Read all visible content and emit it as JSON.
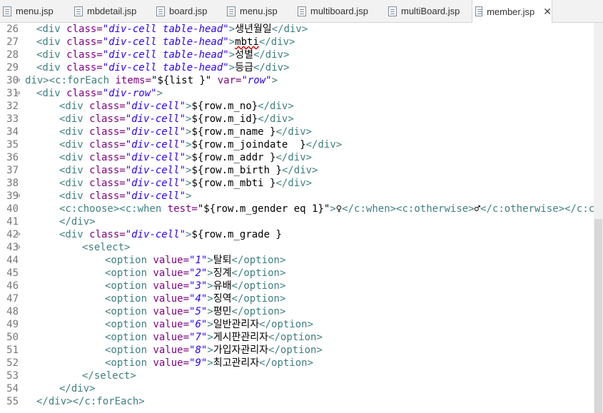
{
  "tabs": [
    {
      "label": "menu.jsp",
      "active": false
    },
    {
      "label": "mbdetail.jsp",
      "active": false
    },
    {
      "label": "board.jsp",
      "active": false
    },
    {
      "label": "menu.jsp",
      "active": false
    },
    {
      "label": "multiboard.jsp",
      "active": false
    },
    {
      "label": "multiBoard.jsp",
      "active": false
    },
    {
      "label": "member.jsp",
      "active": true
    }
  ],
  "icons": {
    "file": "jsp-file-icon",
    "close": "close-icon"
  },
  "colors": {
    "tag": "#3f7f7f",
    "attr": "#7f007f",
    "value": "#2a00ff",
    "text": "#000000",
    "line_number": "#787878"
  },
  "lines": [
    {
      "n": "26",
      "fold": "",
      "indent": 1,
      "toks": [
        [
          "tag",
          "<div "
        ],
        [
          "attr",
          "class="
        ],
        [
          "val",
          "\"div-cell table-head\""
        ],
        [
          "tag",
          ">"
        ],
        [
          "txt",
          "생년월일"
        ],
        [
          "tag",
          "</div>"
        ]
      ]
    },
    {
      "n": "27",
      "fold": "",
      "indent": 1,
      "toks": [
        [
          "tag",
          "<div "
        ],
        [
          "attr",
          "class="
        ],
        [
          "val",
          "\"div-cell table-head\""
        ],
        [
          "tag",
          ">"
        ],
        [
          "sq",
          "mbti"
        ],
        [
          "tag",
          "</div>"
        ]
      ]
    },
    {
      "n": "28",
      "fold": "",
      "indent": 1,
      "toks": [
        [
          "tag",
          "<div "
        ],
        [
          "attr",
          "class="
        ],
        [
          "val",
          "\"div-cell table-head\""
        ],
        [
          "tag",
          ">"
        ],
        [
          "txt",
          "성별"
        ],
        [
          "tag",
          "</div>"
        ]
      ]
    },
    {
      "n": "29",
      "fold": "",
      "indent": 1,
      "toks": [
        [
          "tag",
          "<div "
        ],
        [
          "attr",
          "class="
        ],
        [
          "val",
          "\"div-cell table-head\""
        ],
        [
          "tag",
          ">"
        ],
        [
          "txt",
          "등급"
        ],
        [
          "tag",
          "</div>"
        ]
      ]
    },
    {
      "n": "30",
      "fold": "⊖",
      "indent": 0,
      "toks": [
        [
          "tag",
          "div><c:forEach "
        ],
        [
          "attr",
          "items="
        ],
        [
          "txt",
          "\"${list }\" "
        ],
        [
          "attr",
          "var="
        ],
        [
          "val",
          "\"row\""
        ],
        [
          "tag",
          ">"
        ]
      ]
    },
    {
      "n": "31",
      "fold": "⊖",
      "indent": 1,
      "toks": [
        [
          "tag",
          "<div "
        ],
        [
          "attr",
          "class="
        ],
        [
          "val",
          "\"div-row\""
        ],
        [
          "tag",
          ">"
        ]
      ]
    },
    {
      "n": "32",
      "fold": "",
      "indent": 2,
      "toks": [
        [
          "tag",
          "<div "
        ],
        [
          "attr",
          "class="
        ],
        [
          "val",
          "\"div-cell\""
        ],
        [
          "tag",
          ">"
        ],
        [
          "txt",
          "${row.m_no}"
        ],
        [
          "tag",
          "</div>"
        ]
      ]
    },
    {
      "n": "33",
      "fold": "",
      "indent": 2,
      "toks": [
        [
          "tag",
          "<div "
        ],
        [
          "attr",
          "class="
        ],
        [
          "val",
          "\"div-cell\""
        ],
        [
          "tag",
          ">"
        ],
        [
          "txt",
          "${row.m_id}"
        ],
        [
          "tag",
          "</div>"
        ]
      ]
    },
    {
      "n": "34",
      "fold": "",
      "indent": 2,
      "toks": [
        [
          "tag",
          "<div "
        ],
        [
          "attr",
          "class="
        ],
        [
          "val",
          "\"div-cell\""
        ],
        [
          "tag",
          ">"
        ],
        [
          "txt",
          "${row.m_name }"
        ],
        [
          "tag",
          "</div>"
        ]
      ]
    },
    {
      "n": "35",
      "fold": "",
      "indent": 2,
      "toks": [
        [
          "tag",
          "<div "
        ],
        [
          "attr",
          "class="
        ],
        [
          "val",
          "\"div-cell\""
        ],
        [
          "tag",
          ">"
        ],
        [
          "txt",
          "${row.m_joindate  }"
        ],
        [
          "tag",
          "</div>"
        ]
      ]
    },
    {
      "n": "36",
      "fold": "",
      "indent": 2,
      "toks": [
        [
          "tag",
          "<div "
        ],
        [
          "attr",
          "class="
        ],
        [
          "val",
          "\"div-cell\""
        ],
        [
          "tag",
          ">"
        ],
        [
          "txt",
          "${row.m_addr }"
        ],
        [
          "tag",
          "</div>"
        ]
      ]
    },
    {
      "n": "37",
      "fold": "",
      "indent": 2,
      "toks": [
        [
          "tag",
          "<div "
        ],
        [
          "attr",
          "class="
        ],
        [
          "val",
          "\"div-cell\""
        ],
        [
          "tag",
          ">"
        ],
        [
          "txt",
          "${row.m_birth }"
        ],
        [
          "tag",
          "</div>"
        ]
      ]
    },
    {
      "n": "38",
      "fold": "",
      "indent": 2,
      "toks": [
        [
          "tag",
          "<div "
        ],
        [
          "attr",
          "class="
        ],
        [
          "val",
          "\"div-cell\""
        ],
        [
          "tag",
          ">"
        ],
        [
          "txt",
          "${row.m_mbti }"
        ],
        [
          "tag",
          "</div>"
        ]
      ]
    },
    {
      "n": "39",
      "fold": "⊖",
      "indent": 2,
      "toks": [
        [
          "tag",
          "<div "
        ],
        [
          "attr",
          "class="
        ],
        [
          "val",
          "\"div-cell\""
        ],
        [
          "tag",
          ">"
        ]
      ]
    },
    {
      "n": "40",
      "fold": "",
      "indent": 2,
      "toks": [
        [
          "tag",
          "<c:choose><c:when "
        ],
        [
          "attr",
          "test="
        ],
        [
          "txt",
          "\"${row.m_gender eq 1}\""
        ],
        [
          "tag",
          ">"
        ],
        [
          "txt",
          "♀"
        ],
        [
          "tag",
          "</c:when><c:otherwise>"
        ],
        [
          "txt",
          "♂"
        ],
        [
          "tag",
          "</c:otherwise></c:choose"
        ]
      ]
    },
    {
      "n": "41",
      "fold": "",
      "indent": 2,
      "toks": [
        [
          "tag",
          "</div>"
        ]
      ]
    },
    {
      "n": "42",
      "fold": "⊖",
      "indent": 2,
      "toks": [
        [
          "tag",
          "<div "
        ],
        [
          "attr",
          "class="
        ],
        [
          "val",
          "\"div-cell\""
        ],
        [
          "tag",
          ">"
        ],
        [
          "txt",
          "${row.m_grade }"
        ]
      ]
    },
    {
      "n": "43",
      "fold": "⊖",
      "indent": 3,
      "toks": [
        [
          "tag",
          "<select>"
        ]
      ]
    },
    {
      "n": "44",
      "fold": "",
      "indent": 4,
      "toks": [
        [
          "tag",
          "<option "
        ],
        [
          "attr",
          "value="
        ],
        [
          "val",
          "\"1\""
        ],
        [
          "tag",
          ">"
        ],
        [
          "txt",
          "탈퇴"
        ],
        [
          "tag",
          "</option>"
        ]
      ]
    },
    {
      "n": "45",
      "fold": "",
      "indent": 4,
      "toks": [
        [
          "tag",
          "<option "
        ],
        [
          "attr",
          "value="
        ],
        [
          "val",
          "\"2\""
        ],
        [
          "tag",
          ">"
        ],
        [
          "txt",
          "징계"
        ],
        [
          "tag",
          "</option>"
        ]
      ]
    },
    {
      "n": "46",
      "fold": "",
      "indent": 4,
      "toks": [
        [
          "tag",
          "<option "
        ],
        [
          "attr",
          "value="
        ],
        [
          "val",
          "\"3\""
        ],
        [
          "tag",
          ">"
        ],
        [
          "txt",
          "유배"
        ],
        [
          "tag",
          "</option>"
        ]
      ]
    },
    {
      "n": "47",
      "fold": "",
      "indent": 4,
      "toks": [
        [
          "tag",
          "<option "
        ],
        [
          "attr",
          "value="
        ],
        [
          "val",
          "\"4\""
        ],
        [
          "tag",
          ">"
        ],
        [
          "txt",
          "징역"
        ],
        [
          "tag",
          "</option>"
        ]
      ]
    },
    {
      "n": "48",
      "fold": "",
      "indent": 4,
      "toks": [
        [
          "tag",
          "<option "
        ],
        [
          "attr",
          "value="
        ],
        [
          "val",
          "\"5\""
        ],
        [
          "tag",
          ">"
        ],
        [
          "txt",
          "평민"
        ],
        [
          "tag",
          "</option>"
        ]
      ]
    },
    {
      "n": "49",
      "fold": "",
      "indent": 4,
      "toks": [
        [
          "tag",
          "<option "
        ],
        [
          "attr",
          "value="
        ],
        [
          "val",
          "\"6\""
        ],
        [
          "tag",
          ">"
        ],
        [
          "txt",
          "일반관리자"
        ],
        [
          "tag",
          "</option>"
        ]
      ]
    },
    {
      "n": "50",
      "fold": "",
      "indent": 4,
      "toks": [
        [
          "tag",
          "<option "
        ],
        [
          "attr",
          "value="
        ],
        [
          "val",
          "\"7\""
        ],
        [
          "tag",
          ">"
        ],
        [
          "txt",
          "게시판관리자"
        ],
        [
          "tag",
          "</option>"
        ]
      ]
    },
    {
      "n": "51",
      "fold": "",
      "indent": 4,
      "toks": [
        [
          "tag",
          "<option "
        ],
        [
          "attr",
          "value="
        ],
        [
          "val",
          "\"8\""
        ],
        [
          "tag",
          ">"
        ],
        [
          "txt",
          "가입자관리자"
        ],
        [
          "tag",
          "</option>"
        ]
      ]
    },
    {
      "n": "52",
      "fold": "",
      "indent": 4,
      "toks": [
        [
          "tag",
          "<option "
        ],
        [
          "attr",
          "value="
        ],
        [
          "val",
          "\"9\""
        ],
        [
          "tag",
          ">"
        ],
        [
          "txt",
          "최고관리자"
        ],
        [
          "tag",
          "</option>"
        ]
      ]
    },
    {
      "n": "53",
      "fold": "",
      "indent": 3,
      "toks": [
        [
          "tag",
          "</select>"
        ]
      ]
    },
    {
      "n": "54",
      "fold": "",
      "indent": 2,
      "toks": [
        [
          "tag",
          "</div>"
        ]
      ]
    },
    {
      "n": "55",
      "fold": "",
      "indent": 1,
      "toks": [
        [
          "tag",
          "</div></c:forEach>"
        ]
      ]
    }
  ]
}
